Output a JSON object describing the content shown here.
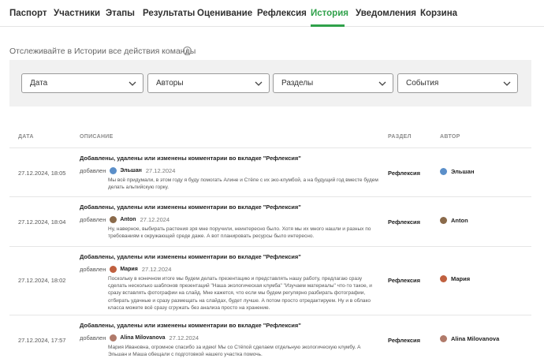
{
  "tabs": [
    {
      "label": "Паспорт"
    },
    {
      "label": "Участники"
    },
    {
      "label": "Этапы"
    },
    {
      "label": "Результаты"
    },
    {
      "label": "Оценивание"
    },
    {
      "label": "Рефлексия"
    },
    {
      "label": "История",
      "active": true
    },
    {
      "label": "Уведомления"
    },
    {
      "label": "Корзина"
    }
  ],
  "subtitle": "Отслеживайте в Истории все действия команды",
  "info_icon": "info-icon",
  "filters": [
    {
      "label": "Дата"
    },
    {
      "label": "Авторы"
    },
    {
      "label": "Разделы"
    },
    {
      "label": "События"
    }
  ],
  "table": {
    "headers": {
      "date": "ДАТА",
      "description": "ОПИСАНИЕ",
      "section": "РАЗДЕЛ",
      "author": "АВТОР"
    },
    "rows": [
      {
        "date": "27.12.2024, 18:05",
        "title": "Добавлены, удалены или изменены комментарии во вкладке \"Рефлексия\"",
        "action": "добавлен",
        "author": "Эльшан",
        "comment_date": "27.12.2024",
        "comment": "Мы всё придумали, в этом году я буду помогать Алине и Стёпе с их эко-клумбой, а на будущий год вместе будем делать альпийскую горку.",
        "section": "Рефлексия",
        "avatar_color": "#5b8fc9"
      },
      {
        "date": "27.12.2024, 18:04",
        "title": "Добавлены, удалены или изменены комментарии во вкладке \"Рефлексия\"",
        "action": "добавлен",
        "author": "Anton",
        "comment_date": "27.12.2024",
        "comment": "Ну, наверное, выбирать растения зря мне поручили, неинтересно было. Хотя мы их много нашли и разных по требованиям к окружающей среде даже. А вот планировать ресурсы было интересно.",
        "section": "Рефлексия",
        "avatar_color": "#8a6a4a"
      },
      {
        "date": "27.12.2024, 18:02",
        "title": "Добавлены, удалены или изменены комментарии во вкладке \"Рефлексия\"",
        "action": "добавлен",
        "author": "Мария",
        "comment_date": "27.12.2024",
        "comment": "Поскольку в конечном итоге мы будем делать презентацию и представлять нашу работу, предлагаю сразу сделать несколько шаблонов презентаций \"Наша экологическая клумба\" \"Изучаем материалы\" что-то такое, и сразу вставлять фотографии на слайд. Мне кажется, что если мы будем регулярно разбирать фотографии, отбирать удачные и сразу размещать на слайдах, будет лучше. А потом просто отредактируем. Ну и в облако класса можете всё сразу сгружать без анализа просто на хранение.",
        "section": "Рефлексия",
        "avatar_color": "#c0603f"
      },
      {
        "date": "27.12.2024, 17:57",
        "title": "Добавлены, удалены или изменены комментарии во вкладке \"Рефлексия\"",
        "action": "добавлен",
        "author": "Alina Milovanova",
        "comment_date": "27.12.2024",
        "comment": "Мария Ивановна, огромное спасибо за идею! Мы со Стёпой сделаем отдельную экологическую клумбу. А Эльшан и Маша обещали с подготовкой нашего участка помочь.",
        "section": "Рефлексия",
        "avatar_color": "#b07a6a"
      }
    ]
  },
  "colors": {
    "accent": "#2fa14a",
    "filter_bg": "#f1f1f1",
    "border": "#e6e6e6"
  }
}
